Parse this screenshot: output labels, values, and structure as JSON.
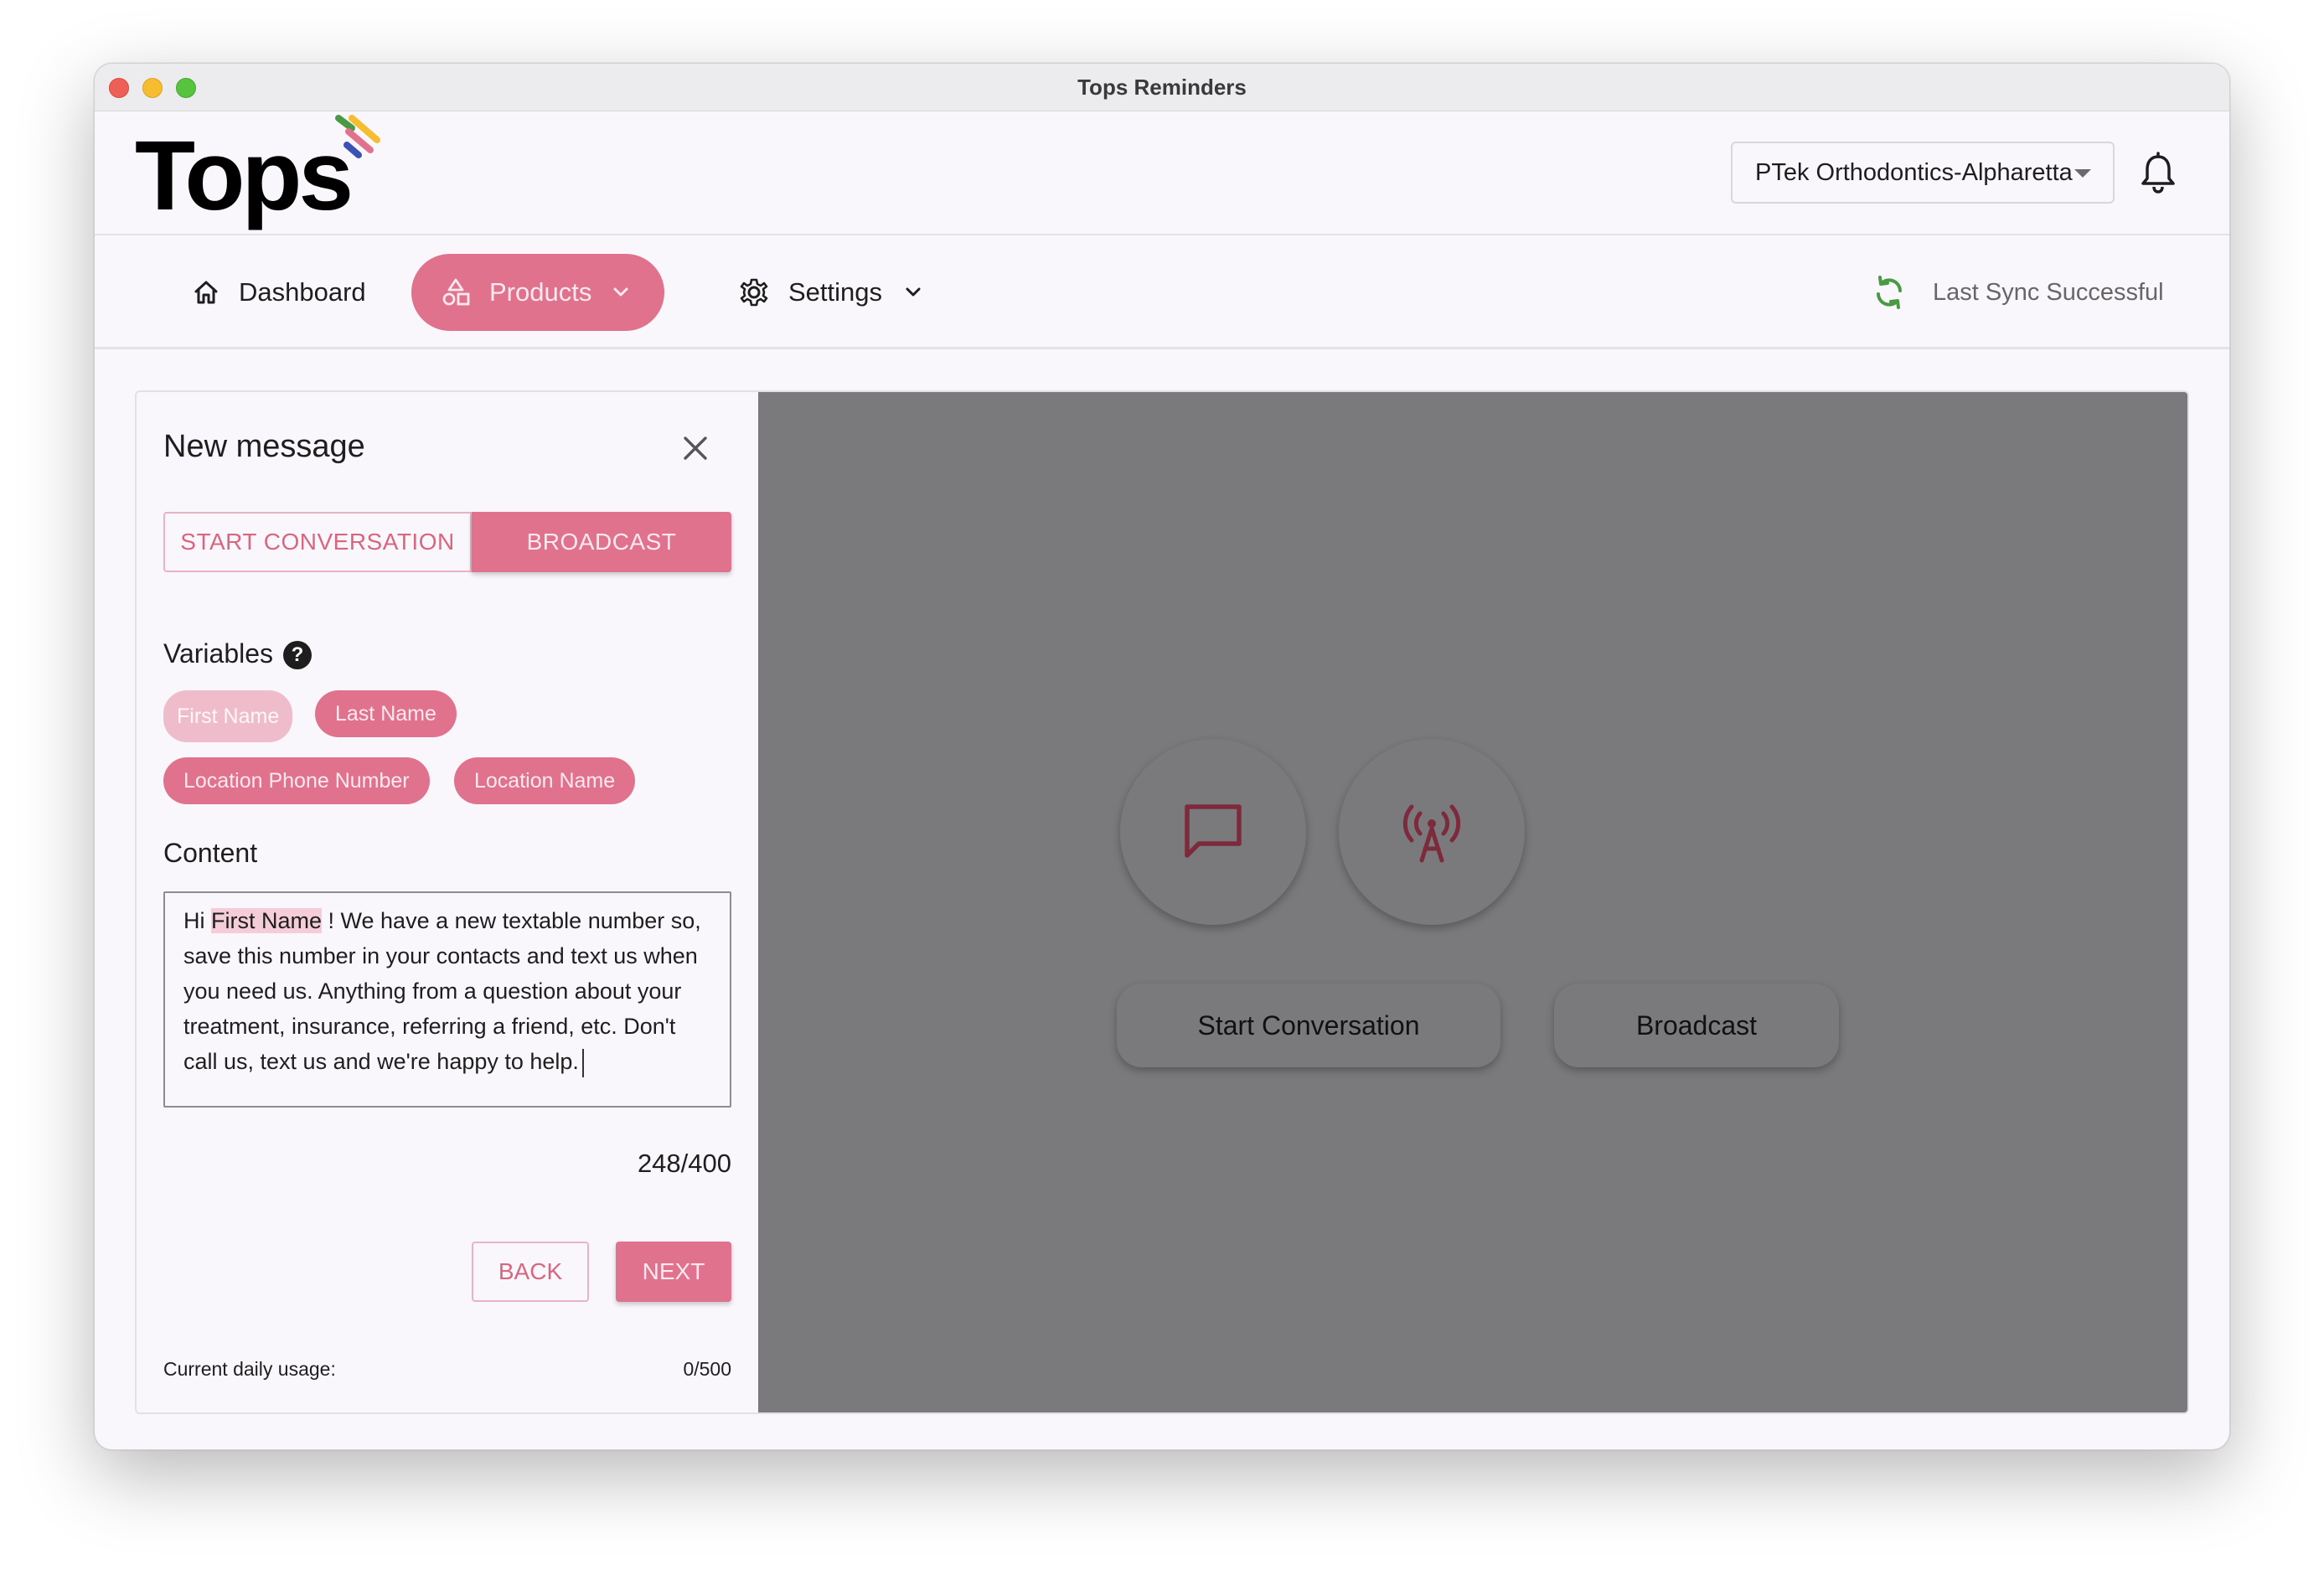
{
  "window": {
    "title": "Tops Reminders"
  },
  "header": {
    "logo_text": "Tops",
    "practice_selector": "PTek Orthodontics-Alpharetta"
  },
  "nav": {
    "dashboard": "Dashboard",
    "products": "Products",
    "settings": "Settings",
    "sync_status": "Last Sync Successful"
  },
  "new_message": {
    "title": "New message",
    "mode_start": "START CONVERSATION",
    "mode_broadcast": "BROADCAST",
    "active_mode": "BROADCAST",
    "variables_label": "Variables",
    "help_glyph": "?",
    "variables": [
      "First Name",
      "Last Name",
      "Location Phone Number",
      "Location Name"
    ],
    "content_label": "Content",
    "content": {
      "pre": "Hi ",
      "variable": "First Name",
      "post": " ! We have a new textable number so, save this number in your contacts and text us when you need us. Anything from a question about your treatment, insurance, referring a friend, etc. Don't call us, text us and we're happy to help."
    },
    "char_count": "248/400",
    "back_label": "BACK",
    "next_label": "NEXT",
    "usage_label": "Current daily usage:",
    "usage_value": "0/500"
  },
  "right_panel": {
    "start_conversation_label": "Start Conversation",
    "broadcast_label": "Broadcast"
  },
  "colors": {
    "accent": "#e1728d",
    "accent_light": "#efbccb",
    "overlay": "#7a7a7c",
    "sync_icon": "#4a9a45",
    "icon_dark_red": "#7c2a3c"
  }
}
